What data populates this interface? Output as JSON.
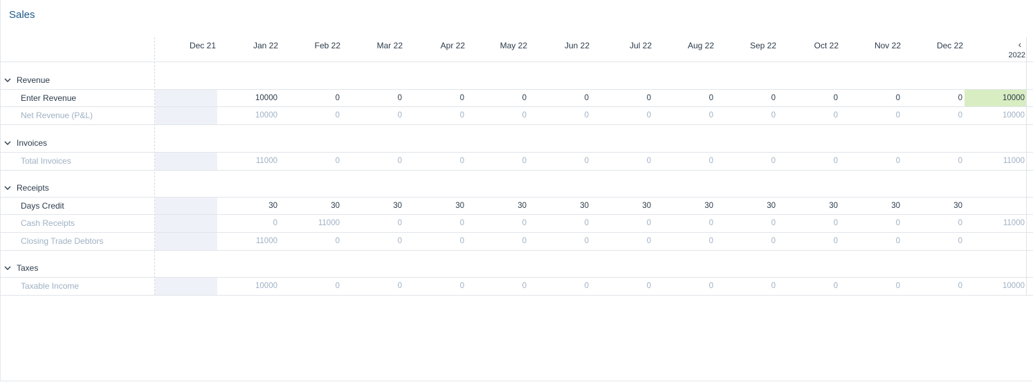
{
  "page": {
    "title": "Sales"
  },
  "header": {
    "months": [
      "Dec 21",
      "Jan 22",
      "Feb 22",
      "Mar 22",
      "Apr 22",
      "May 22",
      "Jun 22",
      "Jul 22",
      "Aug 22",
      "Sep 22",
      "Oct 22",
      "Nov 22",
      "Dec 22"
    ],
    "year": "2022",
    "nav_icon": "chevron-left-icon"
  },
  "colors": {
    "title": "#1d5a8a",
    "total_highlight": "#d8edc1",
    "blank_cell": "#eef2f8",
    "muted_text": "#9fb1c4"
  },
  "sections": [
    {
      "label": "Revenue",
      "rows": [
        {
          "label": "Enter Revenue",
          "editable": true,
          "values": [
            "10000",
            "0",
            "0",
            "0",
            "0",
            "0",
            "0",
            "0",
            "0",
            "0",
            "0",
            "0"
          ],
          "total": "10000",
          "total_highlight": true
        },
        {
          "label": "Net Revenue (P&L)",
          "editable": false,
          "values": [
            "10000",
            "0",
            "0",
            "0",
            "0",
            "0",
            "0",
            "0",
            "0",
            "0",
            "0",
            "0"
          ],
          "total": "10000",
          "total_highlight": false
        }
      ]
    },
    {
      "label": "Invoices",
      "rows": [
        {
          "label": "Total Invoices",
          "editable": false,
          "values": [
            "11000",
            "0",
            "0",
            "0",
            "0",
            "0",
            "0",
            "0",
            "0",
            "0",
            "0",
            "0"
          ],
          "total": "11000",
          "total_highlight": false
        }
      ]
    },
    {
      "label": "Receipts",
      "rows": [
        {
          "label": "Days Credit",
          "editable": true,
          "values": [
            "30",
            "30",
            "30",
            "30",
            "30",
            "30",
            "30",
            "30",
            "30",
            "30",
            "30",
            "30"
          ],
          "total": "",
          "total_highlight": false
        },
        {
          "label": "Cash Receipts",
          "editable": false,
          "values": [
            "0",
            "11000",
            "0",
            "0",
            "0",
            "0",
            "0",
            "0",
            "0",
            "0",
            "0",
            "0"
          ],
          "total": "11000",
          "total_highlight": false
        },
        {
          "label": "Closing Trade Debtors",
          "editable": false,
          "values": [
            "11000",
            "0",
            "0",
            "0",
            "0",
            "0",
            "0",
            "0",
            "0",
            "0",
            "0",
            "0"
          ],
          "total": "",
          "total_highlight": false
        }
      ]
    },
    {
      "label": "Taxes",
      "rows": [
        {
          "label": "Taxable Income",
          "editable": false,
          "values": [
            "10000",
            "0",
            "0",
            "0",
            "0",
            "0",
            "0",
            "0",
            "0",
            "0",
            "0",
            "0"
          ],
          "total": "10000",
          "total_highlight": false
        }
      ]
    }
  ]
}
